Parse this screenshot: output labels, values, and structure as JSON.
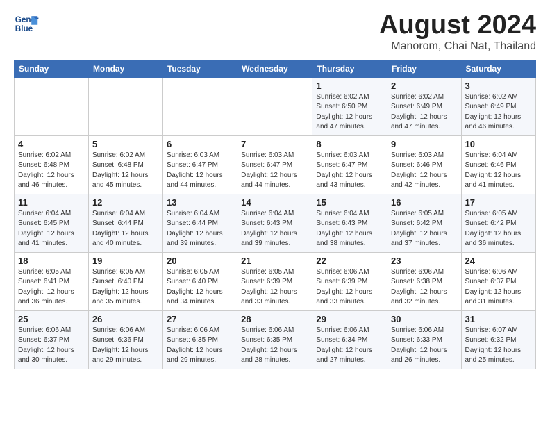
{
  "header": {
    "logo_line1": "General",
    "logo_line2": "Blue",
    "main_title": "August 2024",
    "sub_title": "Manorom, Chai Nat, Thailand"
  },
  "days_of_week": [
    "Sunday",
    "Monday",
    "Tuesday",
    "Wednesday",
    "Thursday",
    "Friday",
    "Saturday"
  ],
  "weeks": [
    [
      {
        "day": "",
        "info": ""
      },
      {
        "day": "",
        "info": ""
      },
      {
        "day": "",
        "info": ""
      },
      {
        "day": "",
        "info": ""
      },
      {
        "day": "1",
        "info": "Sunrise: 6:02 AM\nSunset: 6:50 PM\nDaylight: 12 hours\nand 47 minutes."
      },
      {
        "day": "2",
        "info": "Sunrise: 6:02 AM\nSunset: 6:49 PM\nDaylight: 12 hours\nand 47 minutes."
      },
      {
        "day": "3",
        "info": "Sunrise: 6:02 AM\nSunset: 6:49 PM\nDaylight: 12 hours\nand 46 minutes."
      }
    ],
    [
      {
        "day": "4",
        "info": "Sunrise: 6:02 AM\nSunset: 6:48 PM\nDaylight: 12 hours\nand 46 minutes."
      },
      {
        "day": "5",
        "info": "Sunrise: 6:02 AM\nSunset: 6:48 PM\nDaylight: 12 hours\nand 45 minutes."
      },
      {
        "day": "6",
        "info": "Sunrise: 6:03 AM\nSunset: 6:47 PM\nDaylight: 12 hours\nand 44 minutes."
      },
      {
        "day": "7",
        "info": "Sunrise: 6:03 AM\nSunset: 6:47 PM\nDaylight: 12 hours\nand 44 minutes."
      },
      {
        "day": "8",
        "info": "Sunrise: 6:03 AM\nSunset: 6:47 PM\nDaylight: 12 hours\nand 43 minutes."
      },
      {
        "day": "9",
        "info": "Sunrise: 6:03 AM\nSunset: 6:46 PM\nDaylight: 12 hours\nand 42 minutes."
      },
      {
        "day": "10",
        "info": "Sunrise: 6:04 AM\nSunset: 6:46 PM\nDaylight: 12 hours\nand 41 minutes."
      }
    ],
    [
      {
        "day": "11",
        "info": "Sunrise: 6:04 AM\nSunset: 6:45 PM\nDaylight: 12 hours\nand 41 minutes."
      },
      {
        "day": "12",
        "info": "Sunrise: 6:04 AM\nSunset: 6:44 PM\nDaylight: 12 hours\nand 40 minutes."
      },
      {
        "day": "13",
        "info": "Sunrise: 6:04 AM\nSunset: 6:44 PM\nDaylight: 12 hours\nand 39 minutes."
      },
      {
        "day": "14",
        "info": "Sunrise: 6:04 AM\nSunset: 6:43 PM\nDaylight: 12 hours\nand 39 minutes."
      },
      {
        "day": "15",
        "info": "Sunrise: 6:04 AM\nSunset: 6:43 PM\nDaylight: 12 hours\nand 38 minutes."
      },
      {
        "day": "16",
        "info": "Sunrise: 6:05 AM\nSunset: 6:42 PM\nDaylight: 12 hours\nand 37 minutes."
      },
      {
        "day": "17",
        "info": "Sunrise: 6:05 AM\nSunset: 6:42 PM\nDaylight: 12 hours\nand 36 minutes."
      }
    ],
    [
      {
        "day": "18",
        "info": "Sunrise: 6:05 AM\nSunset: 6:41 PM\nDaylight: 12 hours\nand 36 minutes."
      },
      {
        "day": "19",
        "info": "Sunrise: 6:05 AM\nSunset: 6:40 PM\nDaylight: 12 hours\nand 35 minutes."
      },
      {
        "day": "20",
        "info": "Sunrise: 6:05 AM\nSunset: 6:40 PM\nDaylight: 12 hours\nand 34 minutes."
      },
      {
        "day": "21",
        "info": "Sunrise: 6:05 AM\nSunset: 6:39 PM\nDaylight: 12 hours\nand 33 minutes."
      },
      {
        "day": "22",
        "info": "Sunrise: 6:06 AM\nSunset: 6:39 PM\nDaylight: 12 hours\nand 33 minutes."
      },
      {
        "day": "23",
        "info": "Sunrise: 6:06 AM\nSunset: 6:38 PM\nDaylight: 12 hours\nand 32 minutes."
      },
      {
        "day": "24",
        "info": "Sunrise: 6:06 AM\nSunset: 6:37 PM\nDaylight: 12 hours\nand 31 minutes."
      }
    ],
    [
      {
        "day": "25",
        "info": "Sunrise: 6:06 AM\nSunset: 6:37 PM\nDaylight: 12 hours\nand 30 minutes."
      },
      {
        "day": "26",
        "info": "Sunrise: 6:06 AM\nSunset: 6:36 PM\nDaylight: 12 hours\nand 29 minutes."
      },
      {
        "day": "27",
        "info": "Sunrise: 6:06 AM\nSunset: 6:35 PM\nDaylight: 12 hours\nand 29 minutes."
      },
      {
        "day": "28",
        "info": "Sunrise: 6:06 AM\nSunset: 6:35 PM\nDaylight: 12 hours\nand 28 minutes."
      },
      {
        "day": "29",
        "info": "Sunrise: 6:06 AM\nSunset: 6:34 PM\nDaylight: 12 hours\nand 27 minutes."
      },
      {
        "day": "30",
        "info": "Sunrise: 6:06 AM\nSunset: 6:33 PM\nDaylight: 12 hours\nand 26 minutes."
      },
      {
        "day": "31",
        "info": "Sunrise: 6:07 AM\nSunset: 6:32 PM\nDaylight: 12 hours\nand 25 minutes."
      }
    ]
  ]
}
